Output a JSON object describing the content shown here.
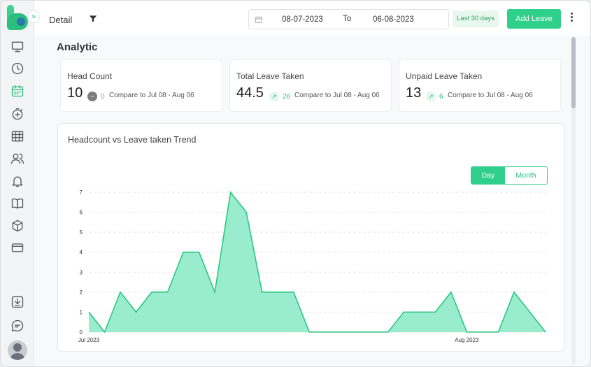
{
  "header": {
    "title": "Detail",
    "date_from": "08-07-2023",
    "to_label": "To",
    "date_to": "06-08-2023",
    "quick_range": "Last 30 days",
    "add_leave_label": "Add Leave"
  },
  "sidebar": {
    "items": [
      "monitor",
      "clock",
      "calendar",
      "stopwatch-plus",
      "table",
      "users",
      "bell",
      "book",
      "box",
      "wallet",
      "download",
      "chat"
    ],
    "active": "calendar"
  },
  "analytic": {
    "title": "Analytic",
    "cards": [
      {
        "label": "Head Count",
        "value": "10",
        "delta": "0",
        "trend": "flat",
        "compare": "Compare to Jul 08 - Aug 06"
      },
      {
        "label": "Total Leave Taken",
        "value": "44.5",
        "delta": "26",
        "trend": "up",
        "compare": "Compare to Jul 08 - Aug 06"
      },
      {
        "label": "Unpaid Leave Taken",
        "value": "13",
        "delta": "6",
        "trend": "up",
        "compare": "Compare to Jul 08 - Aug 06"
      }
    ]
  },
  "chart_section": {
    "title": "Headcount vs Leave taken Trend",
    "toggle": {
      "day_label": "Day",
      "month_label": "Month",
      "selected": "Day"
    }
  },
  "colors": {
    "accent": "#2fcf8c",
    "area_fill": "#9aecce",
    "area_stroke": "#2bc883"
  },
  "chart_data": {
    "type": "area",
    "title": "Headcount vs Leave taken Trend",
    "xlabel": "",
    "ylabel": "",
    "ylim": [
      0,
      7
    ],
    "yticks": [
      0,
      1,
      2,
      3,
      4,
      5,
      6,
      7
    ],
    "grid": true,
    "x_tick_labels": [
      {
        "index": 0,
        "label": "Jul 2023"
      },
      {
        "index": 24,
        "label": "Aug 2023"
      }
    ],
    "values": [
      1,
      0,
      2,
      1,
      2,
      2,
      4,
      4,
      2,
      7,
      6,
      2,
      2,
      2,
      0,
      0,
      0,
      0,
      0,
      0,
      1,
      1,
      1,
      2,
      0,
      0,
      0,
      2,
      1,
      0
    ]
  }
}
